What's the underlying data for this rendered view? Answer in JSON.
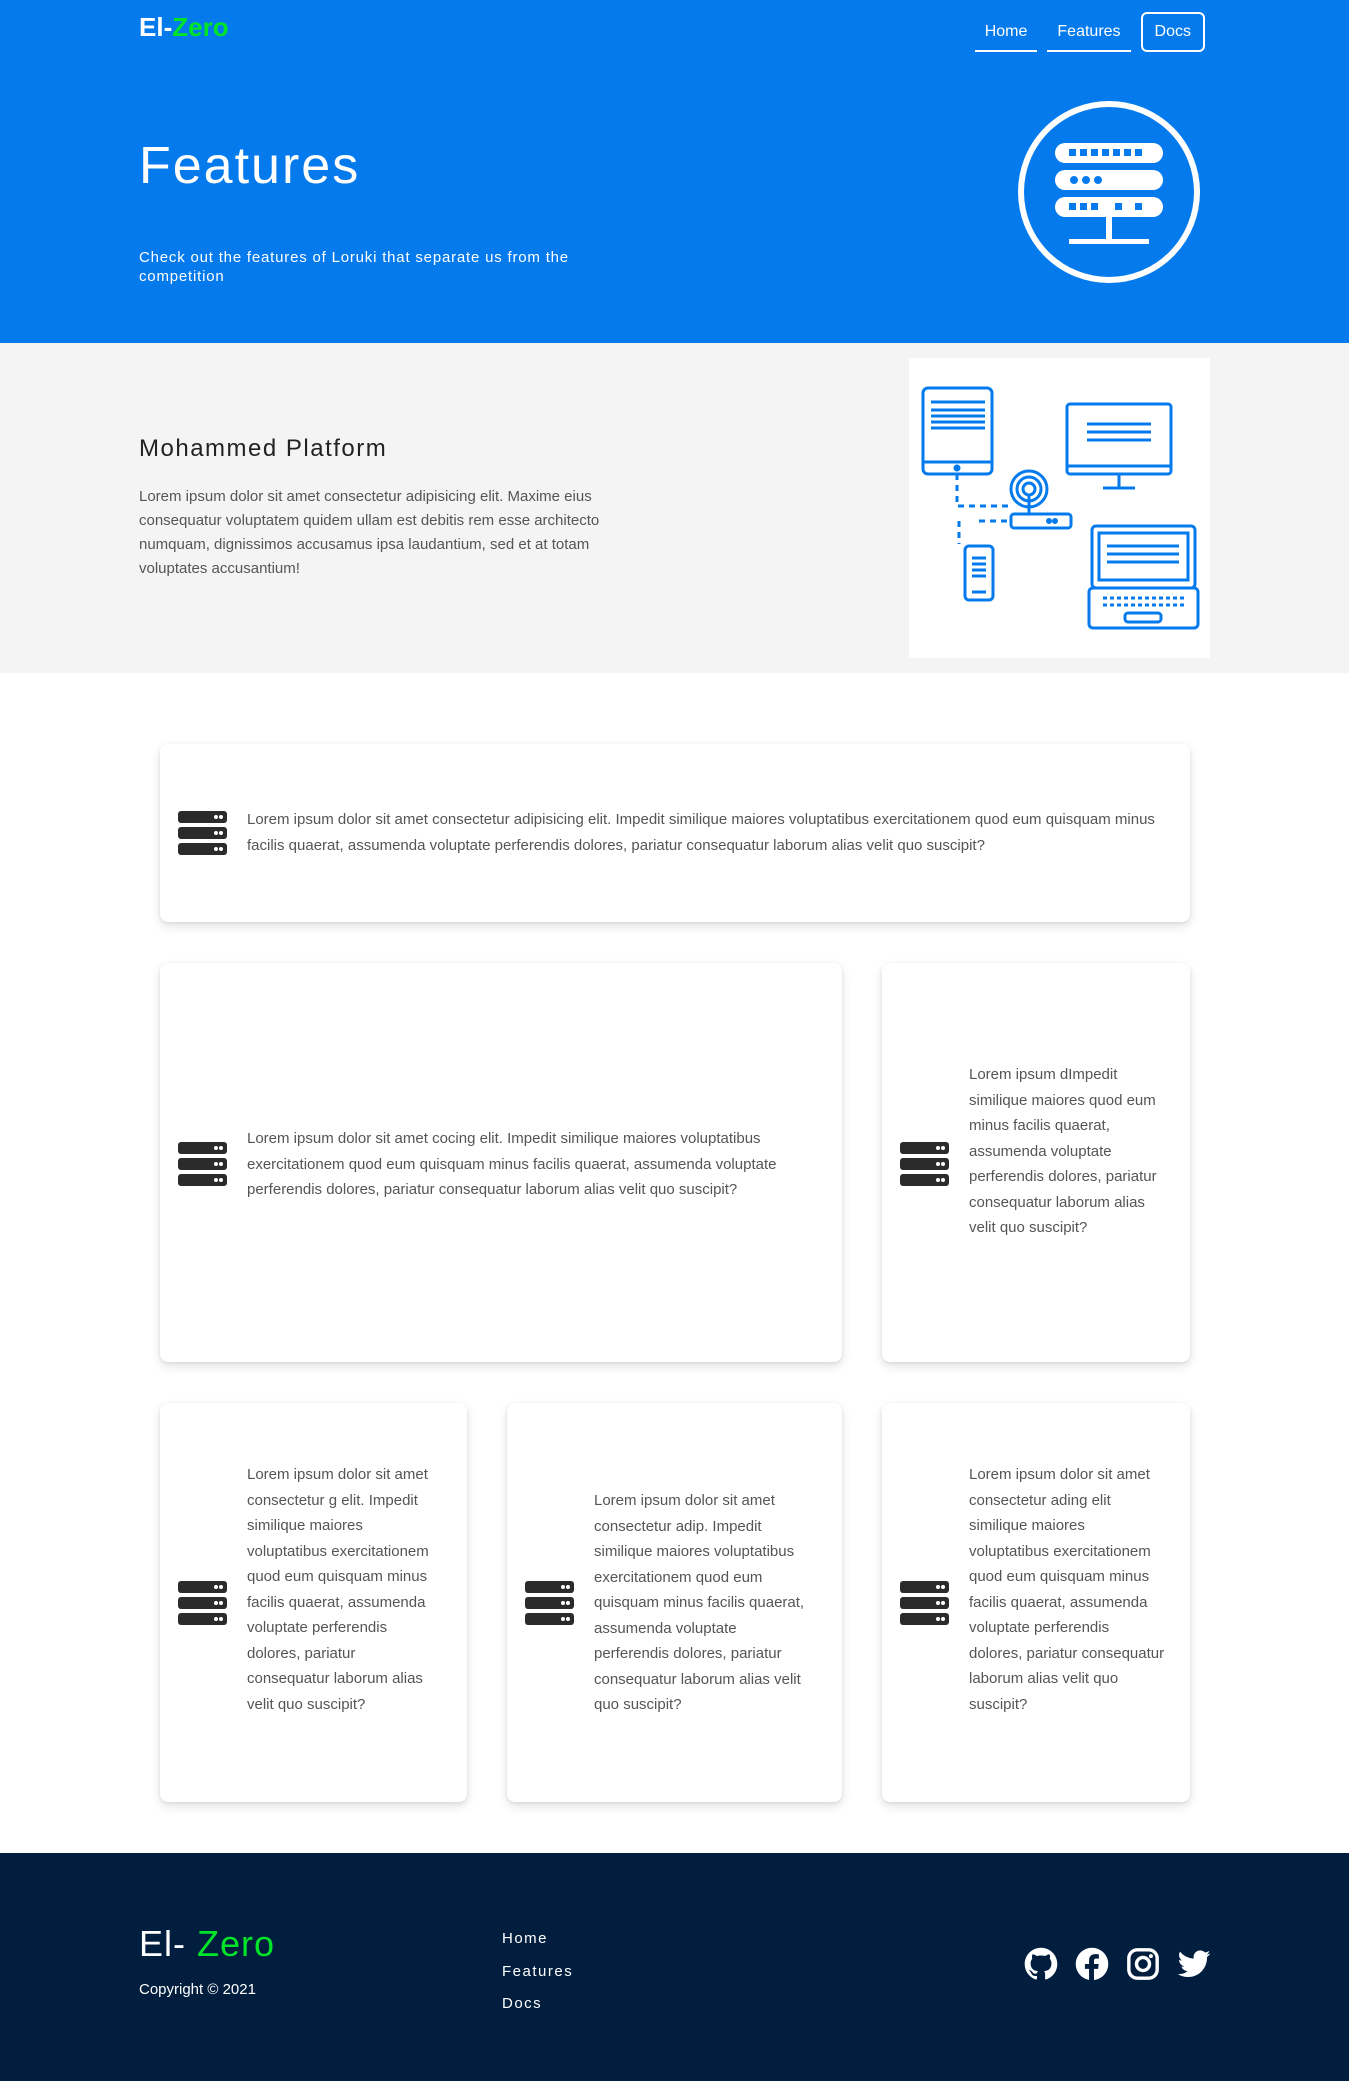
{
  "header": {
    "logo_part1": "El-",
    "logo_part2": "Zero",
    "nav": [
      {
        "label": "Home"
      },
      {
        "label": "Features"
      },
      {
        "label": "Docs"
      }
    ]
  },
  "hero": {
    "title": "Features",
    "subtitle": "Check out the features of Loruki that separate us from the competition",
    "icon": "server-icon"
  },
  "platform": {
    "title": "Mohammed Platform",
    "text": "Lorem ipsum dolor sit amet consectetur adipisicing elit. Maxime eius consequatur voluptatem quidem ullam est debitis rem esse architecto numquam, dignissimos accusamus ipsa laudantium, sed et at totam voluptates accusantium!",
    "image": "network-devices-illustration"
  },
  "cards": [
    {
      "text": "Lorem ipsum dolor sit amet consectetur adipisicing elit. Impedit similique maiores voluptatibus exercitationem quod eum quisquam minus facilis quaerat, assumenda voluptate perferendis dolores, pariatur consequatur laborum alias velit quo suscipit?"
    },
    {
      "text": "Lorem ipsum dolor sit amet cocing elit. Impedit similique maiores voluptatibus exercitationem quod eum quisquam minus facilis quaerat, assumenda voluptate perferendis dolores, pariatur consequatur laborum alias velit quo suscipit?"
    },
    {
      "text": "Lorem ipsum dImpedit similique maiores quod eum minus facilis quaerat, assumenda voluptate perferendis dolores, pariatur consequatur laborum alias velit quo suscipit?"
    },
    {
      "text": "Lorem ipsum dolor sit amet consectetur g elit. Impedit similique maiores voluptatibus exercitationem quod eum quisquam minus facilis quaerat, assumenda voluptate perferendis dolores, pariatur consequatur laborum alias velit quo suscipit?"
    },
    {
      "text": "Lorem ipsum dolor sit amet consectetur adip. Impedit similique maiores voluptatibus exercitationem quod eum quisquam minus facilis quaerat, assumenda voluptate perferendis dolores, pariatur consequatur laborum alias velit quo suscipit?"
    },
    {
      "text": "Lorem ipsum dolor sit amet consectetur ading elit similique maiores voluptatibus exercitationem quod eum quisquam minus facilis quaerat, assumenda voluptate perferendis dolores, pariatur consequatur laborum alias velit quo suscipit?"
    }
  ],
  "card_icon": "server-icon",
  "footer": {
    "logo_part1": "El- ",
    "logo_part2": "Zero",
    "copyright": "Copyright © 2021",
    "links": [
      {
        "label": "Home"
      },
      {
        "label": "Features"
      },
      {
        "label": "Docs"
      }
    ],
    "social": [
      "github-icon",
      "facebook-icon",
      "instagram-icon",
      "twitter-icon"
    ]
  },
  "colors": {
    "primary": "#047aed",
    "accent": "#00e42a",
    "dark": "#011e3e",
    "light": "#f4f4f4"
  }
}
